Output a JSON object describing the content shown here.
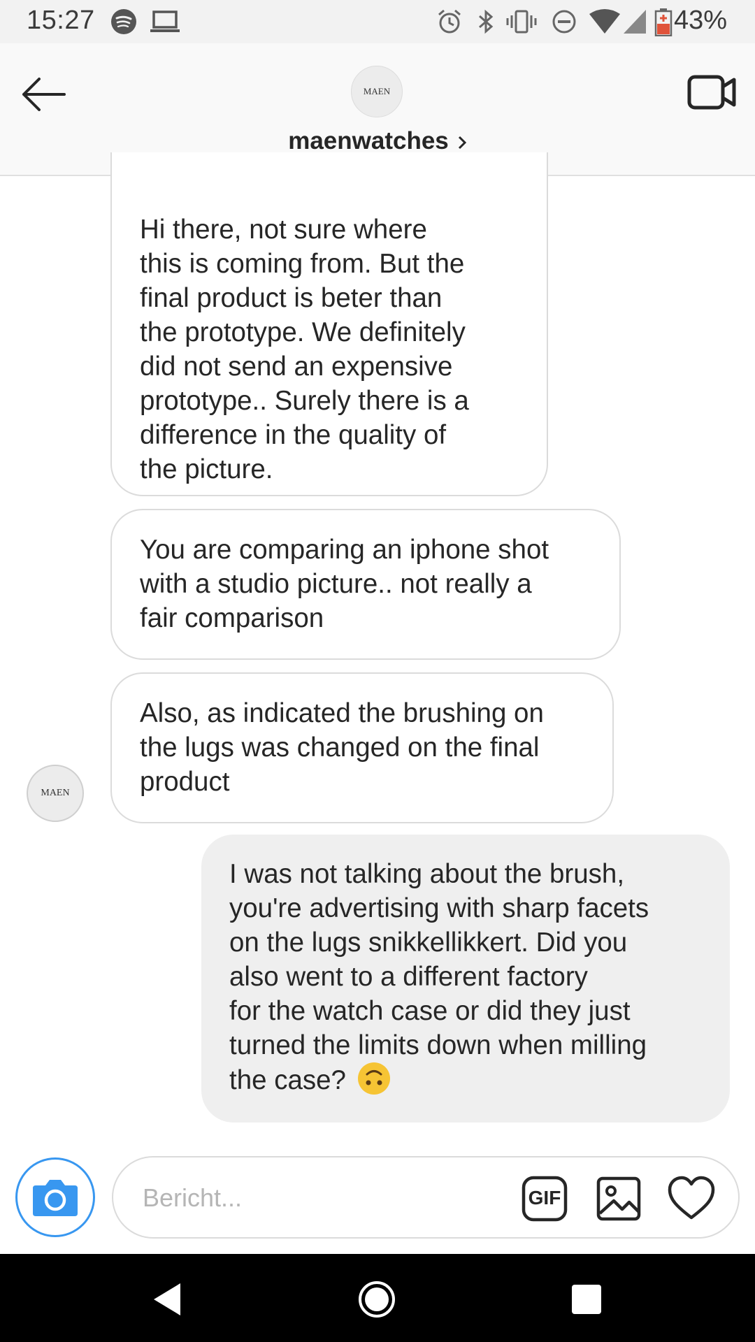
{
  "status_bar": {
    "time": "15:27",
    "battery_percent": "43%",
    "icons": [
      "spotify-icon",
      "laptop-icon",
      "alarm-icon",
      "bluetooth-icon",
      "vibrate-icon",
      "dnd-icon",
      "wifi-icon",
      "signal-icon",
      "battery-icon"
    ]
  },
  "header": {
    "username": "maenwatches",
    "avatar_text": "MAEN",
    "back_icon": "arrow-left-icon",
    "video_icon": "video-call-icon"
  },
  "messages": [
    {
      "sender": "maenwatches",
      "direction": "incoming",
      "text": "Hi there, not sure where\nthis is coming from. But the\nfinal product is beter than\nthe prototype. We definitely\ndid not send an expensive\nprototype.. Surely there is a\ndifference in the quality of\nthe picture."
    },
    {
      "sender": "maenwatches",
      "direction": "incoming",
      "text": "You are comparing an iphone shot\nwith a studio picture.. not really a\nfair comparison"
    },
    {
      "sender": "maenwatches",
      "direction": "incoming",
      "text": "Also, as indicated the brushing on\nthe lugs was changed on the final\nproduct"
    },
    {
      "sender": "me",
      "direction": "outgoing",
      "text": "I was not talking about the brush,\nyou're advertising with sharp facets\non the lugs snikkellikkert. Did you\nalso went to a different factory\nfor the watch case or did they just\nturned the limits down when milling\nthe case?",
      "emoji": "upside-down-face-emoji"
    }
  ],
  "sender_avatar_text": "MAEN",
  "composer": {
    "placeholder": "Bericht...",
    "value": "",
    "gif_label": "GIF",
    "icons": [
      "camera-icon",
      "gif-icon",
      "image-icon",
      "heart-icon"
    ]
  },
  "nav_bar": {
    "icons": [
      "back-triangle-icon",
      "home-circle-icon",
      "recents-square-icon"
    ]
  },
  "colors": {
    "accent": "#3897f0",
    "incoming_border": "#dbdbdb",
    "outgoing_bg": "#efefef",
    "battery_low": "#e0533a"
  }
}
